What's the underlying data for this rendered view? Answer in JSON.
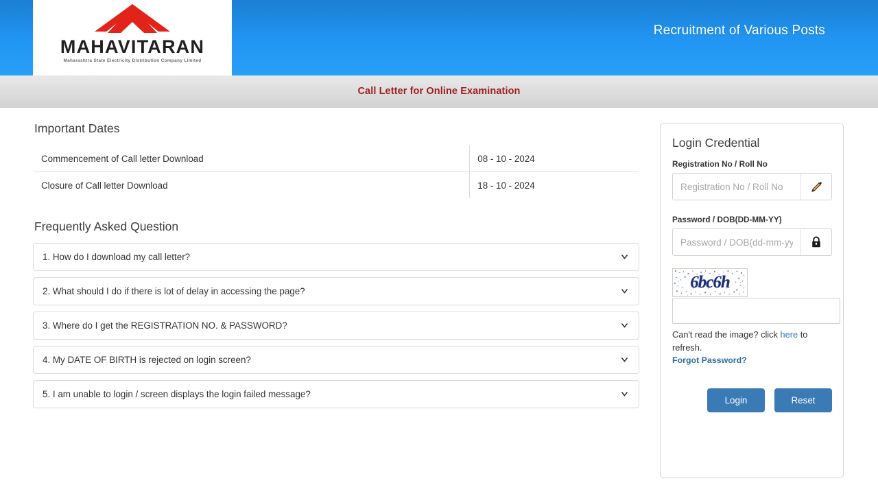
{
  "header": {
    "logo": {
      "wordmark": "MAHAVITARAN",
      "subtitle": "Maharashtra State Electricity Distribution Company Limited",
      "mark_color": "#e2231a"
    },
    "title": "Recruitment of Various Posts",
    "gradient_from": "#1b7fd4",
    "gradient_to": "#27a0f7"
  },
  "subbar": {
    "title": "Call Letter for Online Examination",
    "title_color": "#a01c22"
  },
  "important_dates": {
    "heading": "Important Dates",
    "rows": [
      {
        "label": "Commencement of Call letter Download",
        "value": "08 - 10 - 2024"
      },
      {
        "label": "Closure of Call letter Download",
        "value": "18 - 10 - 2024"
      }
    ]
  },
  "faq": {
    "heading": "Frequently Asked Question",
    "items": [
      {
        "question": "1. How do I download my call letter?"
      },
      {
        "question": "2. What should I do if there is lot of delay in accessing the page?"
      },
      {
        "question": "3. Where do I get the REGISTRATION NO. & PASSWORD?"
      },
      {
        "question": "4. My DATE OF BIRTH is rejected on login screen?"
      },
      {
        "question": "5. I am unable to login / screen displays the login failed message?"
      }
    ],
    "toggle_icon": "chevron-down-icon"
  },
  "login": {
    "heading": "Login Credential",
    "registration": {
      "label": "Registration No / Roll No",
      "placeholder": "Registration No / Roll No",
      "value": "",
      "icon": "pencil-icon"
    },
    "password": {
      "label": "Password / DOB(DD-MM-YY)",
      "placeholder": "Password / DOB(dd-mm-yy)",
      "value": "",
      "icon": "lock-icon"
    },
    "captcha": {
      "text": "6bc6h",
      "value": "",
      "placeholder": "",
      "hint_prefix": "Can't read the image? click ",
      "hint_link": "here",
      "hint_suffix": " to refresh.",
      "text_color": "#1b2f7a"
    },
    "forgot_password": "Forgot Password?",
    "login_button": "Login",
    "reset_button": "Reset",
    "button_color": "#3a7ab5"
  }
}
